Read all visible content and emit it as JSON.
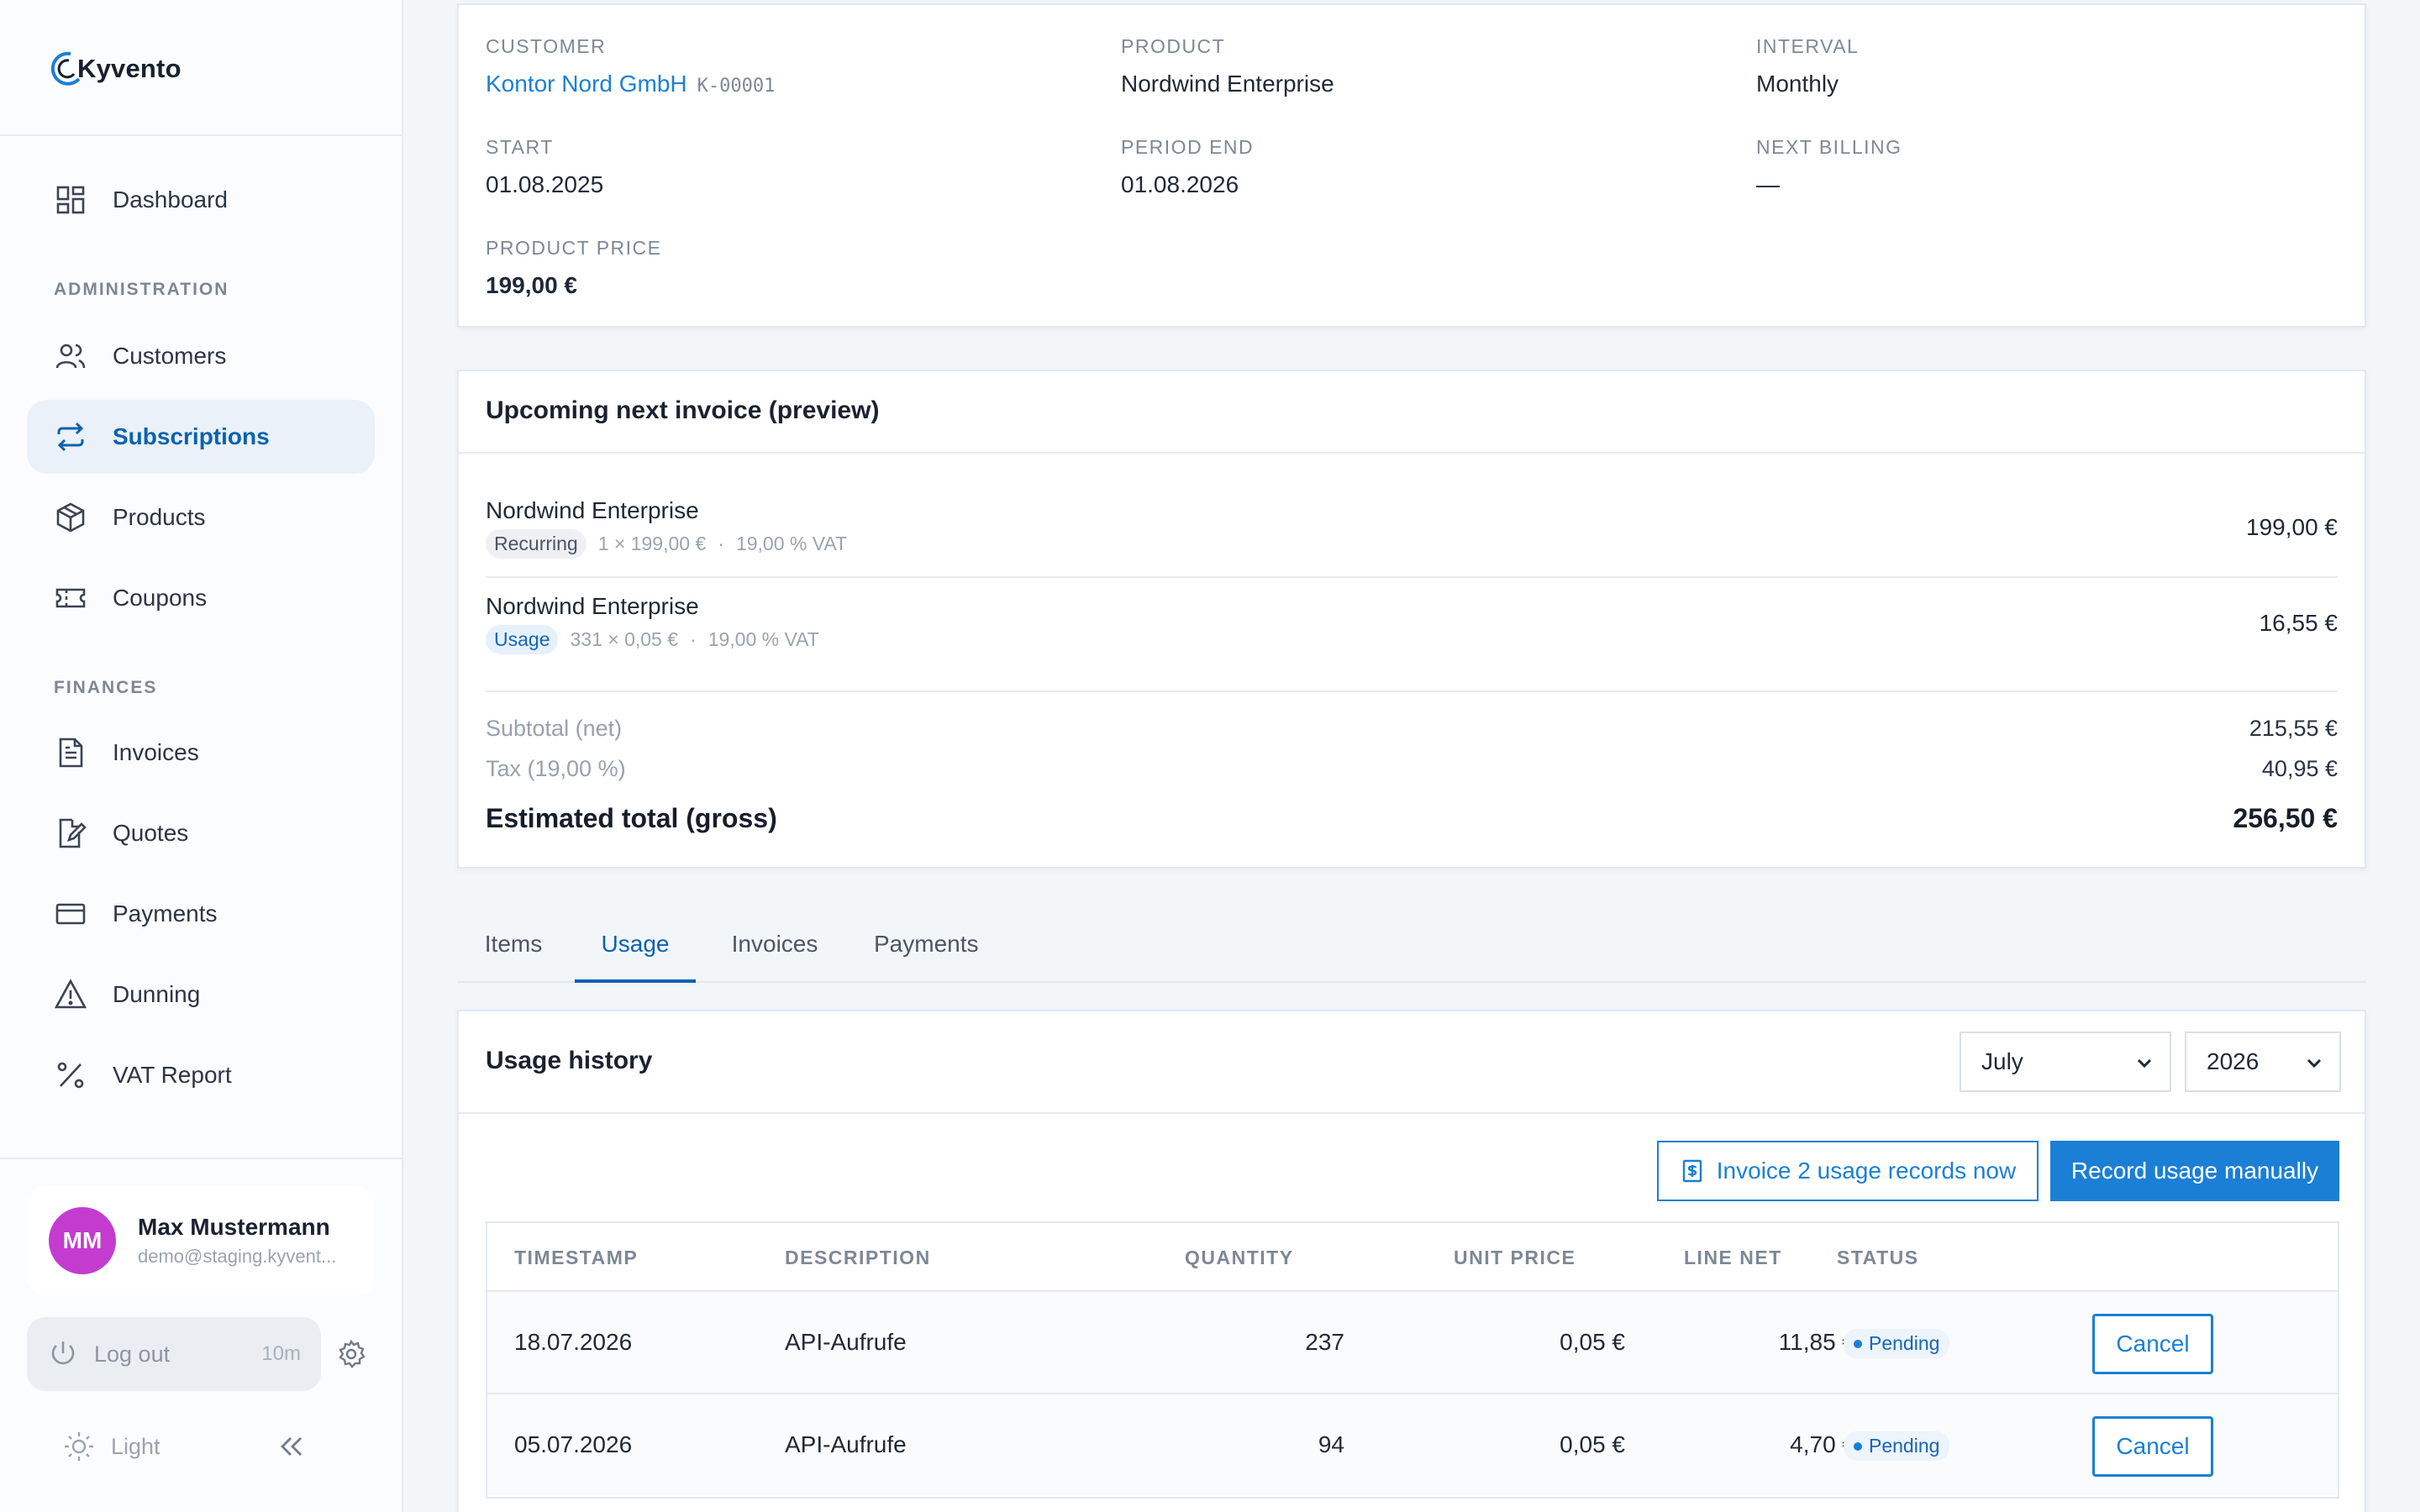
{
  "brand": {
    "name": "Kyvento"
  },
  "sidebar": {
    "dashboard": "Dashboard",
    "section_admin": "ADMINISTRATION",
    "customers": "Customers",
    "subscriptions": "Subscriptions",
    "products": "Products",
    "coupons": "Coupons",
    "section_finances": "FINANCES",
    "invoices": "Invoices",
    "quotes": "Quotes",
    "payments": "Payments",
    "dunning": "Dunning",
    "vat_report": "VAT Report"
  },
  "user": {
    "initials": "MM",
    "name": "Max Mustermann",
    "email": "demo@staging.kyvent...",
    "logout_label": "Log out",
    "session_timer": "10m",
    "theme_label": "Light"
  },
  "subscription": {
    "customer_label": "CUSTOMER",
    "customer_name": "Kontor Nord GmbH",
    "customer_id": "K-00001",
    "product_label": "PRODUCT",
    "product_name": "Nordwind Enterprise",
    "interval_label": "INTERVAL",
    "interval_value": "Monthly",
    "start_label": "START",
    "start_value": "01.08.2025",
    "period_end_label": "PERIOD END",
    "period_end_value": "01.08.2026",
    "next_billing_label": "NEXT BILLING",
    "next_billing_value": "—",
    "product_price_label": "PRODUCT PRICE",
    "product_price_value": "199,00 €"
  },
  "invoice_preview": {
    "title": "Upcoming next invoice (preview)",
    "lines": [
      {
        "name": "Nordwind Enterprise",
        "tag": "Recurring",
        "qty": "1 × 199,00 €",
        "sep": "·",
        "vat": "19,00 % VAT",
        "amount": "199,00 €"
      },
      {
        "name": "Nordwind Enterprise",
        "tag": "Usage",
        "qty": "331 × 0,05 €",
        "sep": "·",
        "vat": "19,00 % VAT",
        "amount": "16,55 €"
      }
    ],
    "subtotal_label": "Subtotal (net)",
    "subtotal_value": "215,55 €",
    "tax_label": "Tax (19,00 %)",
    "tax_value": "40,95 €",
    "total_label": "Estimated total (gross)",
    "total_value": "256,50 €"
  },
  "tabs": [
    "Items",
    "Usage",
    "Invoices",
    "Payments"
  ],
  "usage": {
    "title": "Usage history",
    "month": "July",
    "year": "2026",
    "invoice_now_label": "Invoice 2 usage records now",
    "record_label": "Record usage manually",
    "columns": [
      "TIMESTAMP",
      "DESCRIPTION",
      "QUANTITY",
      "UNIT PRICE",
      "LINE NET",
      "STATUS"
    ],
    "rows": [
      {
        "timestamp": "18.07.2026",
        "description": "API-Aufrufe",
        "quantity": "237",
        "unit_price": "0,05 €",
        "line_net": "11,85 €",
        "status": "Pending",
        "action": "Cancel"
      },
      {
        "timestamp": "05.07.2026",
        "description": "API-Aufrufe",
        "quantity": "94",
        "unit_price": "0,05 €",
        "line_net": "4,70 €",
        "status": "Pending",
        "action": "Cancel"
      }
    ]
  },
  "colors": {
    "accent": "#1b7fd6",
    "active_nav": "#0b62b0",
    "avatar": "#c43ccf"
  }
}
